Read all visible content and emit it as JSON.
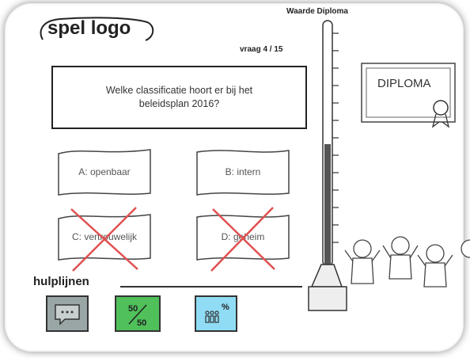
{
  "header": {
    "logo_text": "spel logo",
    "meter_title": "Waarde Diploma",
    "question_counter": "vraag 4 / 15"
  },
  "question": {
    "text": "Welke classificatie hoort er bij het beleidsplan 2016?"
  },
  "answers": [
    {
      "label": "A: openbaar",
      "eliminated": false
    },
    {
      "label": "B: intern",
      "eliminated": false
    },
    {
      "label": "C: vertrouwelijk",
      "eliminated": true
    },
    {
      "label": "D: geheim",
      "eliminated": true
    }
  ],
  "diploma": {
    "text": "DIPLOMA"
  },
  "thermometer": {
    "fill_level": 0.5
  },
  "helpers": {
    "title": "hulplijnen",
    "items": [
      {
        "icon": "chat-icon",
        "color": "#9aa6a6"
      },
      {
        "icon": "fifty-fifty-icon",
        "text_top": "50",
        "text_bottom": "50",
        "color": "#4fc05a"
      },
      {
        "icon": "audience-poll-icon",
        "text": "%",
        "color": "#8fdcf4"
      }
    ]
  },
  "colors": {
    "cross": "#e05050",
    "thermo_fill": "#555555"
  }
}
